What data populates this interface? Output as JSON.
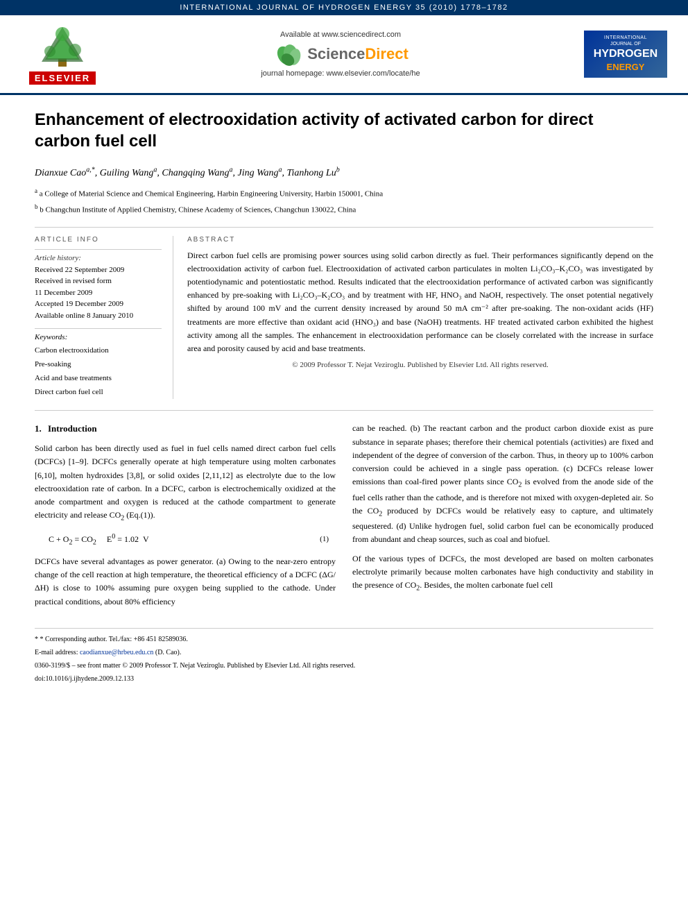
{
  "topbar": {
    "journal_name": "INTERNATIONAL JOURNAL OF HYDROGEN ENERGY 35 (2010) 1778–1782"
  },
  "header": {
    "available_text": "Available at www.sciencedirect.com",
    "homepage_text": "journal homepage: www.elsevier.com/locate/he",
    "elsevier_label": "ELSEVIER",
    "journal_badge": {
      "line1": "INTERNATIONAL",
      "line2": "JOURNAL OF",
      "line3": "HYDROGEN",
      "line4": "ENERGY"
    }
  },
  "paper": {
    "title": "Enhancement of electrooxidation activity of activated carbon for direct carbon fuel cell",
    "authors_line": "Dianxue Caoa,*, Guiling Wanga, Changqing Wanga, Jing Wanga, Tianhong Lub",
    "affiliations": [
      "a College of Material Science and Chemical Engineering, Harbin Engineering University, Harbin 150001, China",
      "b Changchun Institute of Applied Chemistry, Chinese Academy of Sciences, Changchun 130022, China"
    ],
    "article_info": {
      "section_label": "ARTICLE INFO",
      "history_label": "Article history:",
      "received1": "Received 22 September 2009",
      "received2": "Received in revised form",
      "received2b": "11 December 2009",
      "accepted": "Accepted 19 December 2009",
      "available": "Available online 8 January 2010",
      "keywords_label": "Keywords:",
      "keywords": [
        "Carbon electrooxidation",
        "Pre-soaking",
        "Acid and base treatments",
        "Direct carbon fuel cell"
      ]
    },
    "abstract": {
      "section_label": "ABSTRACT",
      "text": "Direct carbon fuel cells are promising power sources using solid carbon directly as fuel. Their performances significantly depend on the electrooxidation activity of carbon fuel. Electrooxidation of activated carbon particulates in molten Li₂CO₃–K₂CO₃ was investigated by potentiodynamic and potentiostatic method. Results indicated that the electrooxidation performance of activated carbon was significantly enhanced by pre-soaking with Li₂CO₃–K₂CO₃ and by treatment with HF, HNO₃ and NaOH, respectively. The onset potential negatively shifted by around 100 mV and the current density increased by around 50 mA cm⁻² after pre-soaking. The non-oxidant acids (HF) treatments are more effective than oxidant acid (HNO₃) and base (NaOH) treatments. HF treated activated carbon exhibited the highest activity among all the samples. The enhancement in electrooxidation performance can be closely correlated with the increase in surface area and porosity caused by acid and base treatments.",
      "copyright": "© 2009 Professor T. Nejat Veziroglu. Published by Elsevier Ltd. All rights reserved."
    },
    "sections": [
      {
        "number": "1.",
        "title": "Introduction",
        "col1_paragraphs": [
          "Solid carbon has been directly used as fuel in fuel cells named direct carbon fuel cells (DCFCs) [1–9]. DCFCs generally operate at high temperature using molten carbonates [6,10], molten hydroxides [3,8], or solid oxides [2,11,12] as electrolyte due to the low electrooxidation rate of carbon. In a DCFC, carbon is electrochemically oxidized at the anode compartment and oxygen is reduced at the cathode compartment to generate electricity and release CO₂ (Eq.(1)).",
          "C + O₂ = CO₂   E⁰ = 1.02  V       (1)",
          "DCFCs have several advantages as power generator. (a) Owing to the near-zero entropy change of the cell reaction at high temperature, the theoretical efficiency of a DCFC (ΔG/ΔH) is close to 100% assuming pure oxygen being supplied to the cathode. Under practical conditions, about 80% efficiency"
        ],
        "col2_paragraphs": [
          "can be reached. (b) The reactant carbon and the product carbon dioxide exist as pure substance in separate phases; therefore their chemical potentials (activities) are fixed and independent of the degree of conversion of the carbon. Thus, in theory up to 100% carbon conversion could be achieved in a single pass operation. (c) DCFCs release lower emissions than coal-fired power plants since CO₂ is evolved from the anode side of the fuel cells rather than the cathode, and is therefore not mixed with oxygen-depleted air. So the CO₂ produced by DCFCs would be relatively easy to capture, and ultimately sequestered. (d) Unlike hydrogen fuel, solid carbon fuel can be economically produced from abundant and cheap sources, such as coal and biofuel.",
          "Of the various types of DCFCs, the most developed are based on molten carbonates electrolyte primarily because molten carbonates have high conductivity and stability in the presence of CO₂. Besides, the molten carbonate fuel cell"
        ]
      }
    ],
    "footnotes": {
      "corresponding_label": "* Corresponding author. Tel./fax: +86 451 82589036.",
      "email_label": "E-mail address:",
      "email_value": "caodianxue@hrbeu.edu.cn",
      "email_suffix": " (D. Cao).",
      "issn_line": "0360-3199/$ – see front matter © 2009 Professor T. Nejat Veziroglu. Published by Elsevier Ltd. All rights reserved.",
      "doi_line": "doi:10.1016/j.ijhydene.2009.12.133"
    }
  }
}
